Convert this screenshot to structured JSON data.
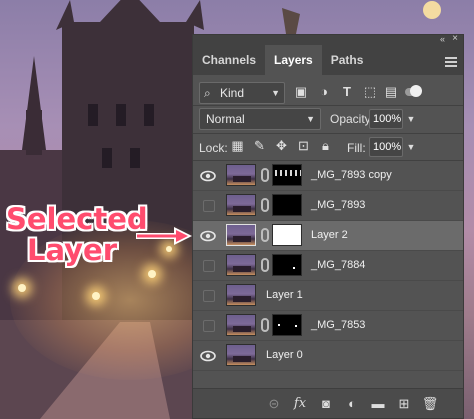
{
  "annotation": {
    "callout_line1": "Selected",
    "callout_line2": "Layer"
  },
  "panel": {
    "tabs": [
      {
        "label": "Channels"
      },
      {
        "label": "Layers"
      },
      {
        "label": "Paths"
      }
    ],
    "filter": {
      "kind_label": "Kind"
    },
    "blend_mode": "Normal",
    "opacity_label": "Opacity:",
    "opacity_value": "100%",
    "lock_label": "Lock:",
    "fill_label": "Fill:",
    "fill_value": "100%",
    "layers": [
      {
        "name": "_MG_7893 copy",
        "visible": true
      },
      {
        "name": "_MG_7893",
        "visible": false
      },
      {
        "name": "Layer 2",
        "visible": true,
        "selected": true
      },
      {
        "name": "_MG_7884",
        "visible": false
      },
      {
        "name": "Layer 1",
        "visible": false
      },
      {
        "name": "_MG_7853",
        "visible": false
      },
      {
        "name": "Layer 0",
        "visible": true
      }
    ]
  },
  "colors": {
    "panel_bg": "#535353",
    "selected_row": "#6b6b6b",
    "callout": "#ff4c6e"
  }
}
